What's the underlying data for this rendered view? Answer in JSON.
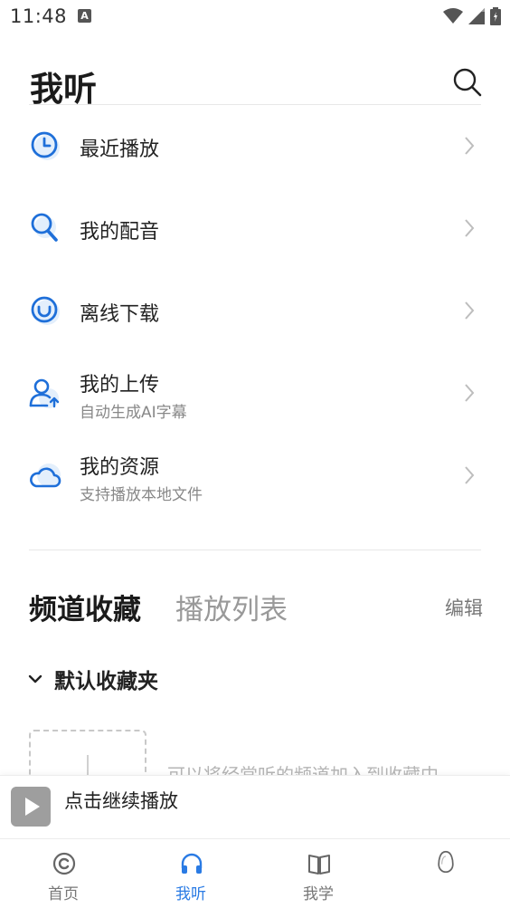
{
  "status_bar": {
    "time": "11:48",
    "notification_letter": "A"
  },
  "header": {
    "title": "我听"
  },
  "menu": [
    {
      "label": "最近播放",
      "icon": "clock-icon"
    },
    {
      "label": "我的配音",
      "icon": "magnifier-icon"
    },
    {
      "label": "离线下载",
      "icon": "download-circle-icon"
    },
    {
      "label": "我的上传",
      "sub": "自动生成AI字幕",
      "icon": "user-upload-icon"
    },
    {
      "label": "我的资源",
      "sub": "支持播放本地文件",
      "icon": "cloud-icon"
    }
  ],
  "collections": {
    "tabs": [
      {
        "label": "频道收藏",
        "active": true
      },
      {
        "label": "播放列表",
        "active": false
      }
    ],
    "edit_label": "编辑",
    "folder_title": "默认收藏夹",
    "empty_hint": "可以将经常听的频道加入到收藏中"
  },
  "player": {
    "label": "点击继续播放"
  },
  "bottom_nav": [
    {
      "label": "首页",
      "icon": "home-disc-icon",
      "active": false
    },
    {
      "label": "我听",
      "icon": "headphones-icon",
      "active": true
    },
    {
      "label": "我学",
      "icon": "book-icon",
      "active": false
    },
    {
      "label": "",
      "icon": "egg-icon",
      "active": false
    }
  ],
  "colors": {
    "accent": "#2a7be4",
    "icon_blue": "#1e6fd9",
    "icon_bg": "#e3effc"
  }
}
